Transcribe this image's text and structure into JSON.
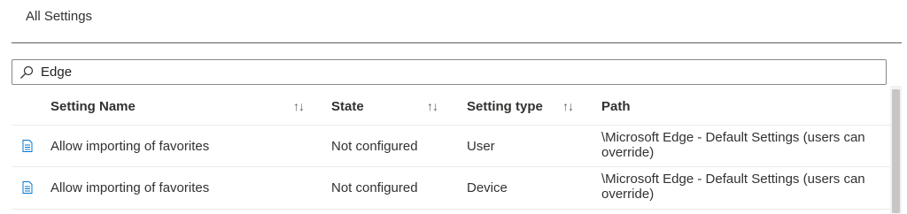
{
  "header": {
    "title": "All Settings"
  },
  "search": {
    "value": "Edge",
    "icon": "search-icon"
  },
  "columns": {
    "setting_name": "Setting Name",
    "state": "State",
    "setting_type": "Setting type",
    "path": "Path",
    "sort_glyph": "↑↓"
  },
  "rows": [
    {
      "name": "Allow importing of favorites",
      "state": "Not configured",
      "type": "User",
      "path": "\\Microsoft Edge - Default Settings (users can override)",
      "icon": "document-icon"
    },
    {
      "name": "Allow importing of favorites",
      "state": "Not configured",
      "type": "Device",
      "path": "\\Microsoft Edge - Default Settings (users can override)",
      "icon": "document-icon"
    }
  ],
  "colors": {
    "icon_blue": "#0078d4",
    "divider": "#605e5c",
    "row_border": "#edebe9"
  }
}
